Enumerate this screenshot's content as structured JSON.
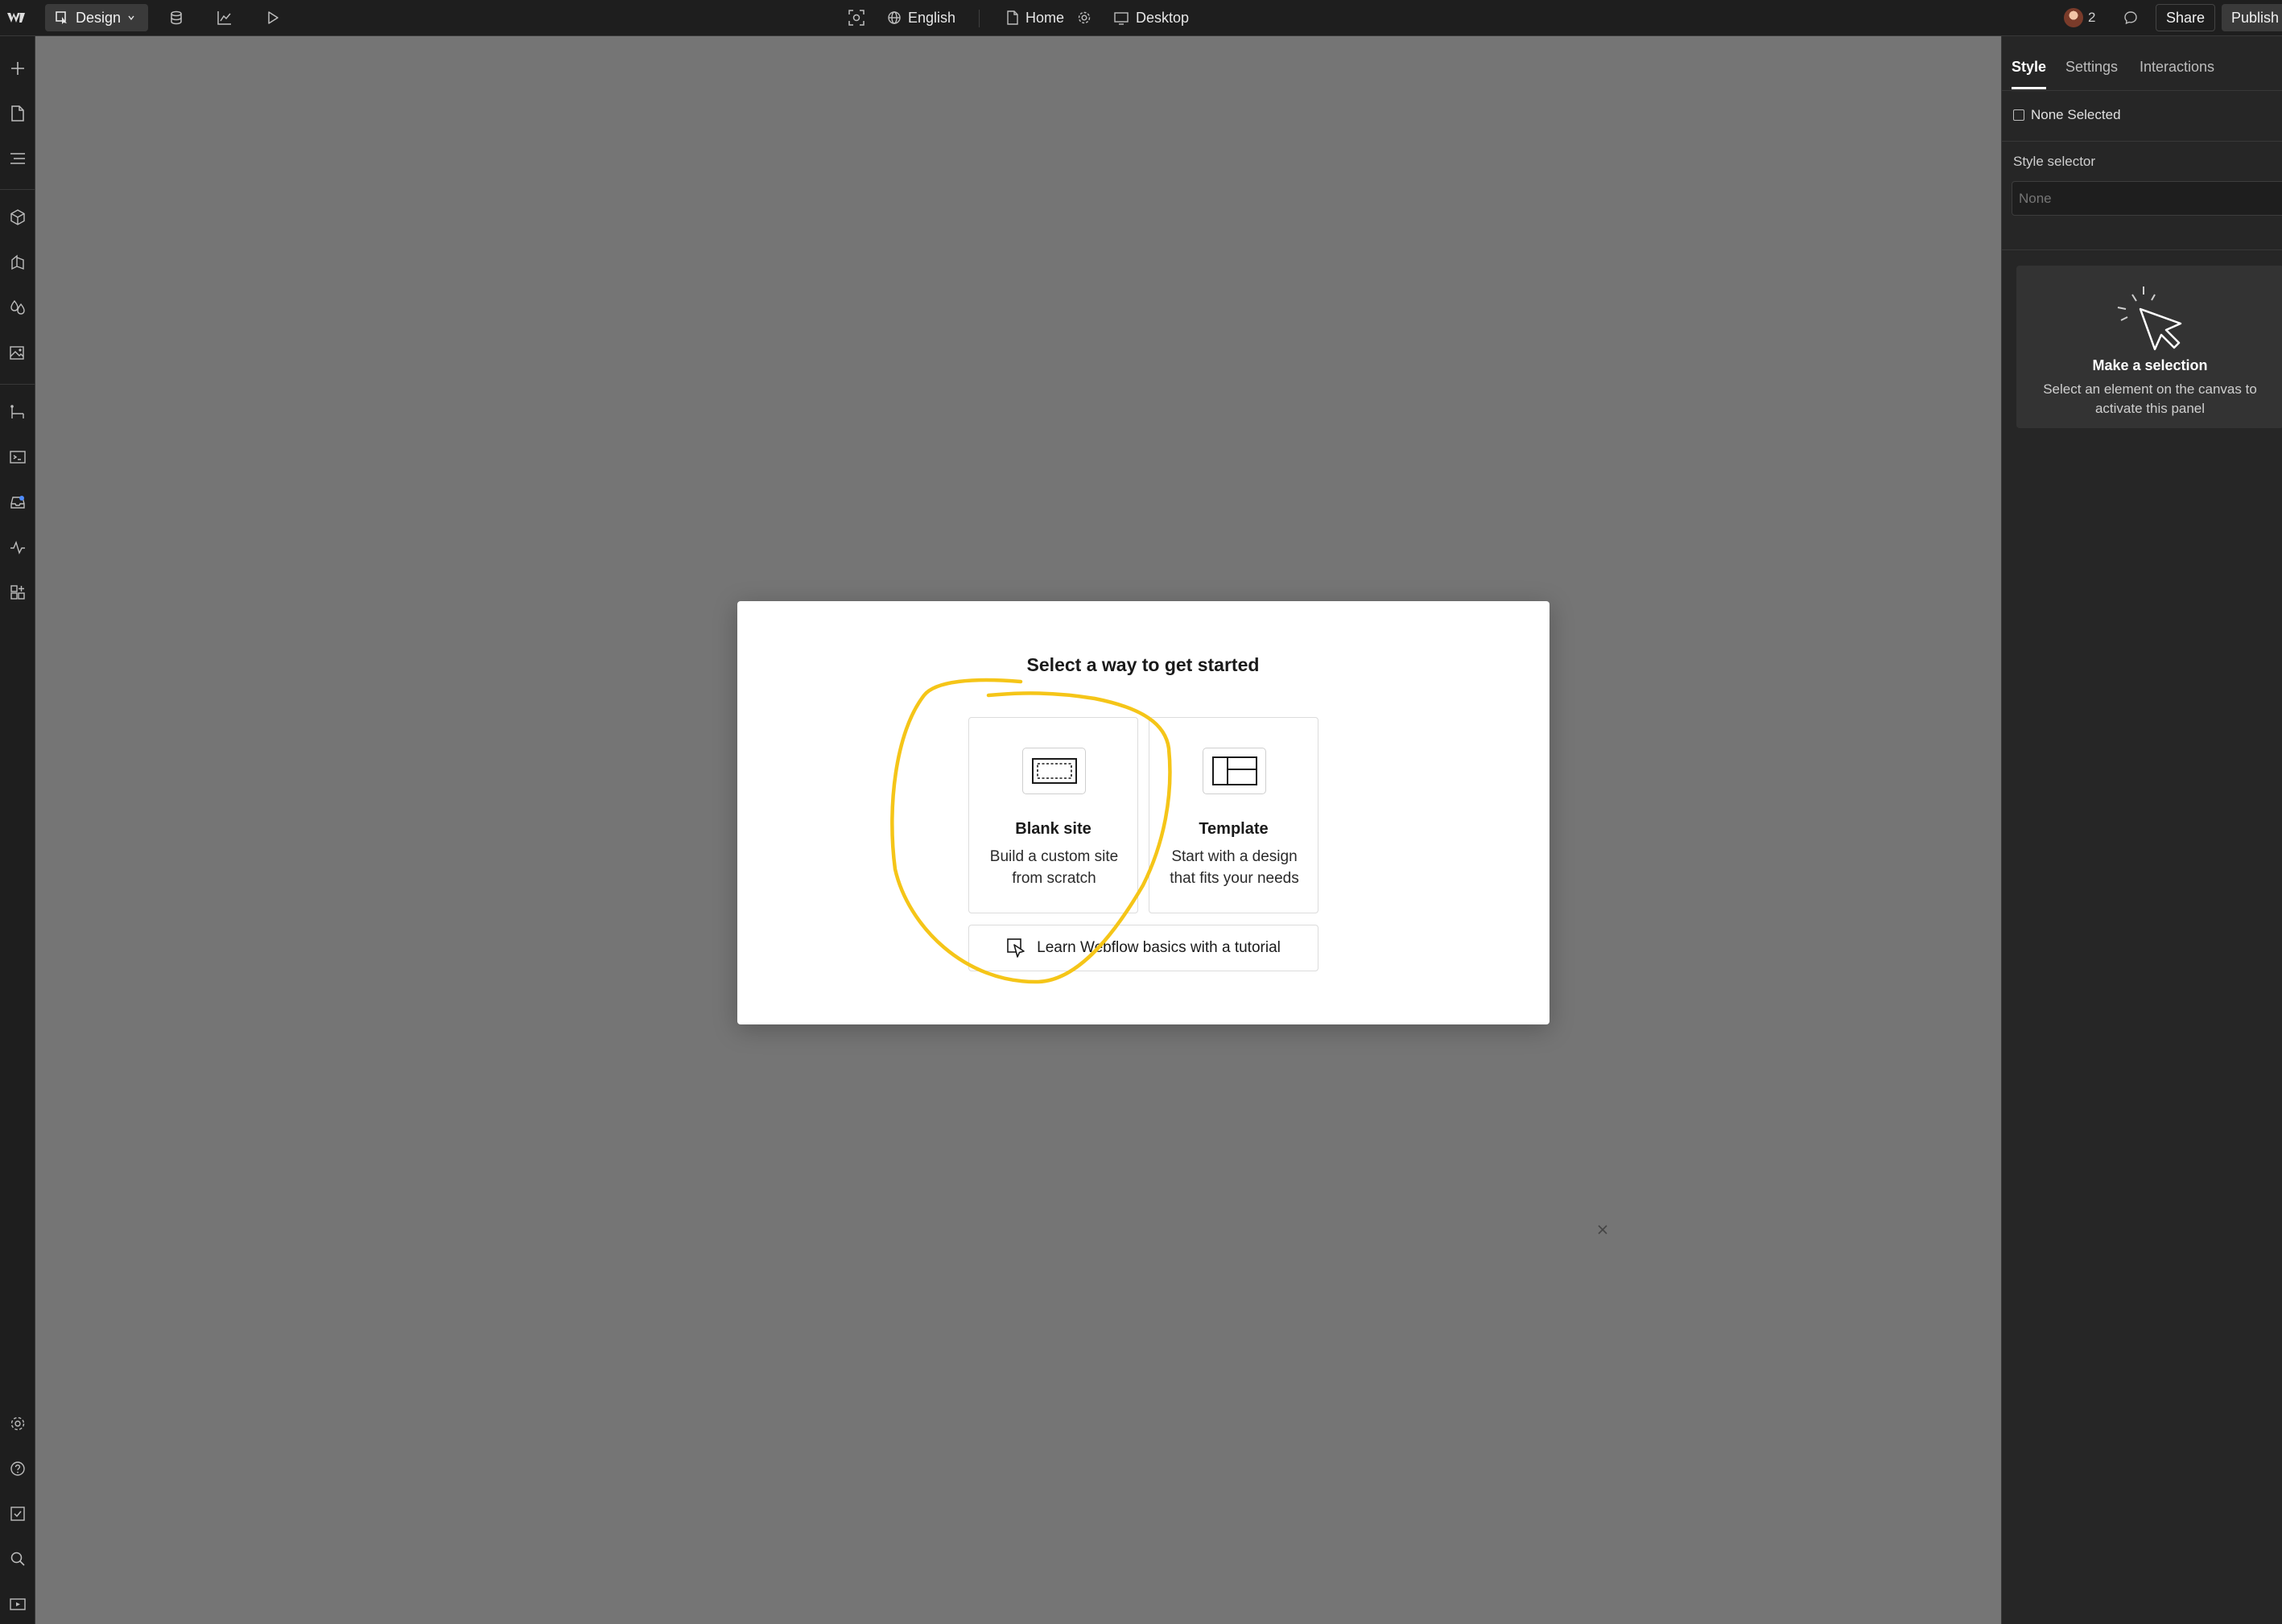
{
  "topbar": {
    "mode_label": "Design",
    "language": "English",
    "page": "Home",
    "breakpoint": "Desktop",
    "collaborator_count": "2",
    "share_label": "Share",
    "publish_label": "Publish"
  },
  "right_panel": {
    "tabs": [
      "Style",
      "Settings",
      "Interactions"
    ],
    "active_tab": "Style",
    "none_selected": "None Selected",
    "style_selector_label": "Style selector",
    "style_selector_placeholder": "None",
    "empty_title": "Make a selection",
    "empty_desc": "Select an element on the canvas to activate this panel"
  },
  "modal": {
    "title": "Select a way to get started",
    "options": [
      {
        "title": "Blank site",
        "desc": "Build a custom site from scratch"
      },
      {
        "title": "Template",
        "desc": "Start with a design that fits your needs"
      }
    ],
    "tutorial_label": "Learn Webflow basics with a tutorial"
  },
  "colors": {
    "canvas": "#757575",
    "chrome": "#1e1e1e",
    "panel": "#262626",
    "annotation": "#f5c518"
  }
}
